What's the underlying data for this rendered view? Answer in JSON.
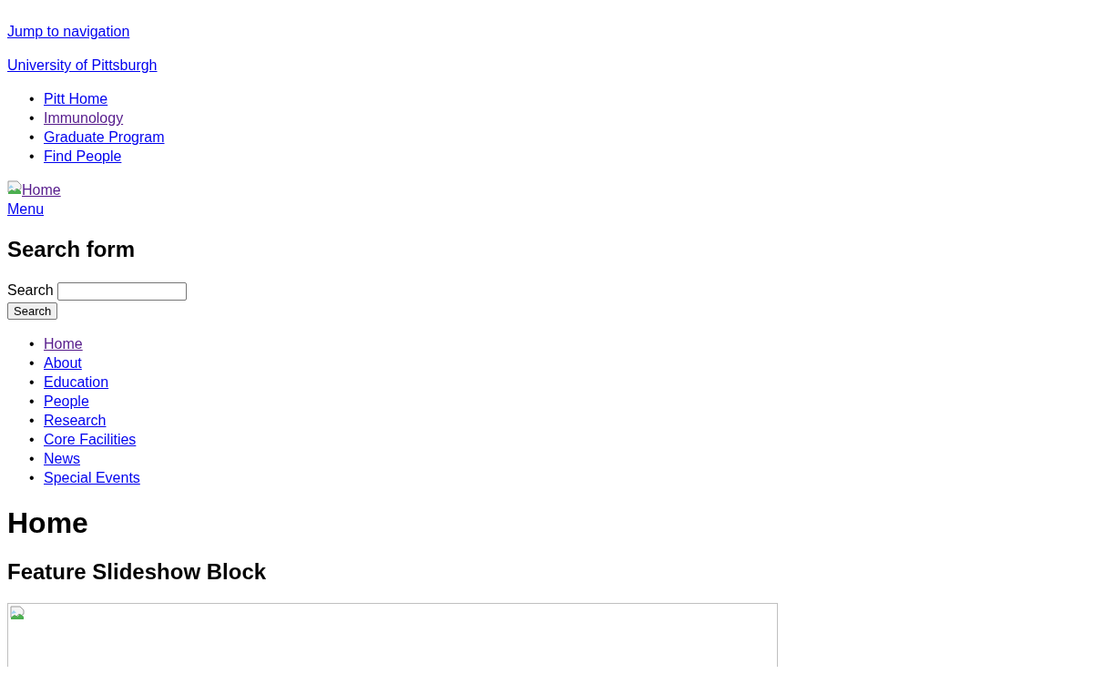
{
  "skip_link": {
    "text": "Jump to navigation",
    "visited": false
  },
  "site_link": {
    "text": "University of Pittsburgh",
    "visited": false
  },
  "top_links": [
    {
      "marker": "•",
      "text": "Pitt Home",
      "visited": false
    },
    {
      "marker": "•",
      "text": "Immunology",
      "visited": true
    },
    {
      "marker": "•",
      "text": "Graduate Program",
      "visited": false
    },
    {
      "marker": "•",
      "text": "Find People",
      "visited": false
    }
  ],
  "logo_link": {
    "alt": "Home",
    "visited": true
  },
  "menu_link": {
    "text": "Menu",
    "visited": false
  },
  "search": {
    "heading": "Search form",
    "label": "Search",
    "button": "Search"
  },
  "main_nav": [
    {
      "marker": "•",
      "text": "Home",
      "visited": true
    },
    {
      "marker": "•",
      "text": "About",
      "visited": false
    },
    {
      "marker": "•",
      "text": "Education",
      "visited": false
    },
    {
      "marker": "•",
      "text": "People",
      "visited": false
    },
    {
      "marker": "•",
      "text": "Research",
      "visited": false
    },
    {
      "marker": "•",
      "text": "Core Facilities",
      "visited": false
    },
    {
      "marker": "•",
      "text": "News",
      "visited": false
    },
    {
      "marker": "•",
      "text": "Special Events",
      "visited": false
    }
  ],
  "page_title": "Home",
  "slideshow": {
    "heading": "Feature Slideshow Block"
  }
}
